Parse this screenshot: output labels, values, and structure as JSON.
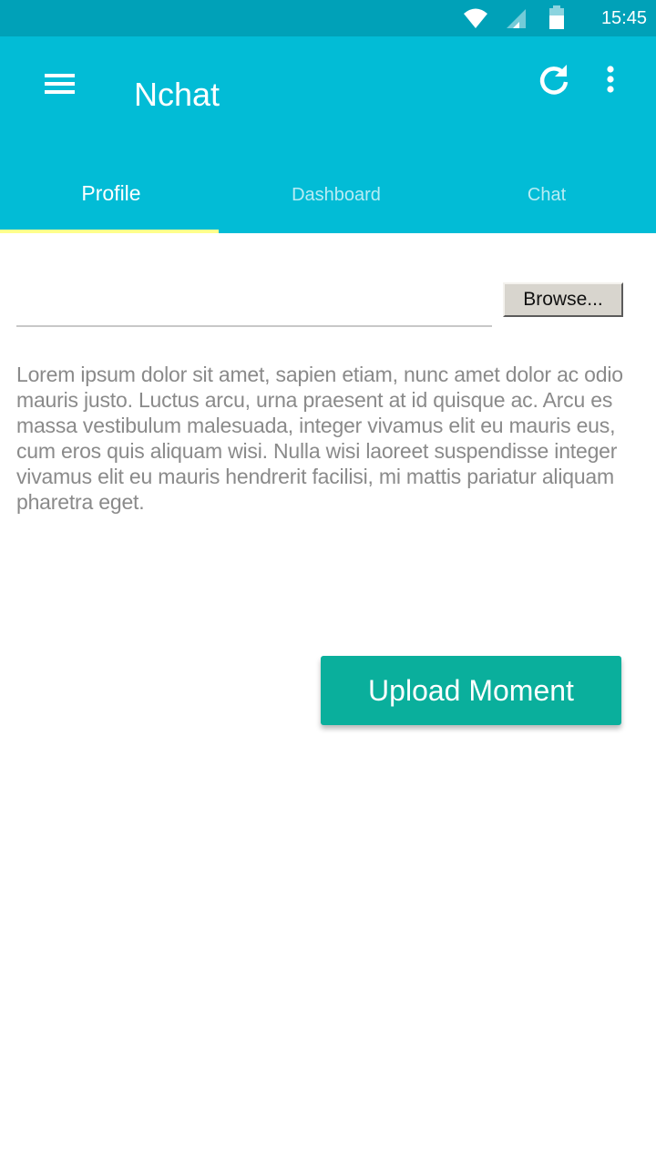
{
  "status_bar": {
    "time": "15:45",
    "icons": [
      "wifi-icon",
      "cell-signal-icon",
      "battery-icon"
    ]
  },
  "app_bar": {
    "title": "Nchat",
    "menu_icon": "hamburger-menu-icon",
    "refresh_icon": "refresh-icon",
    "more_icon": "more-vertical-icon",
    "background_color": "#02bcd6"
  },
  "tabs": [
    {
      "label": "Profile",
      "active": true
    },
    {
      "label": "Dashboard",
      "active": false
    },
    {
      "label": "Chat",
      "active": false
    }
  ],
  "tab_indicator_color": "#ffff8d",
  "profile": {
    "file_input_value": "",
    "browse_label": "Browse...",
    "description": "Lorem ipsum dolor sit amet, sapien etiam, nunc amet dolor ac odio mauris justo. Luctus arcu, urna praesent at id quisque ac. Arcu es massa vestibulum malesuada, integer vivamus elit eu mauris eus, cum eros quis aliquam wisi. Nulla wisi laoreet suspendisse integer vivamus elit eu mauris hendrerit facilisi, mi mattis pariatur aliquam pharetra eget.",
    "upload_label": "Upload Moment",
    "upload_color": "#0aaf9c"
  }
}
